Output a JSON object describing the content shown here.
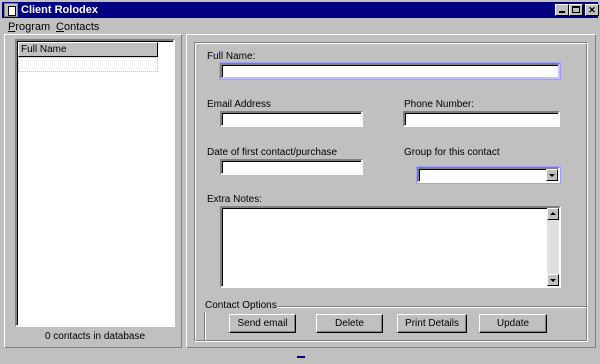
{
  "window": {
    "title": "Client Rolodex"
  },
  "menubar": {
    "items": [
      "Program",
      "Contacts"
    ]
  },
  "contacts_list": {
    "column_header": "Full Name",
    "rows": [],
    "count_text": "0 contacts in database"
  },
  "form": {
    "full_name": {
      "label": "Full Name:",
      "value": ""
    },
    "email": {
      "label": "Email Address",
      "value": ""
    },
    "phone": {
      "label": "Phone Number:",
      "value": ""
    },
    "first_contact_date": {
      "label": "Date of first contact/purchase",
      "value": ""
    },
    "group": {
      "label": "Group for this contact",
      "value": ""
    },
    "notes": {
      "label": "Extra Notes:",
      "value": ""
    }
  },
  "contact_options": {
    "title": "Contact Options",
    "buttons": [
      "Send email",
      "Delete",
      "Print Details",
      "Update"
    ]
  },
  "colors": {
    "titlebar": "#000080",
    "face": "#c0c0c0",
    "focus": "#a0a0ff"
  },
  "icons": [
    "app-icon",
    "minimize-icon",
    "maximize-icon",
    "close-icon",
    "dropdown-arrow-icon",
    "scroll-up-icon",
    "scroll-down-icon"
  ]
}
